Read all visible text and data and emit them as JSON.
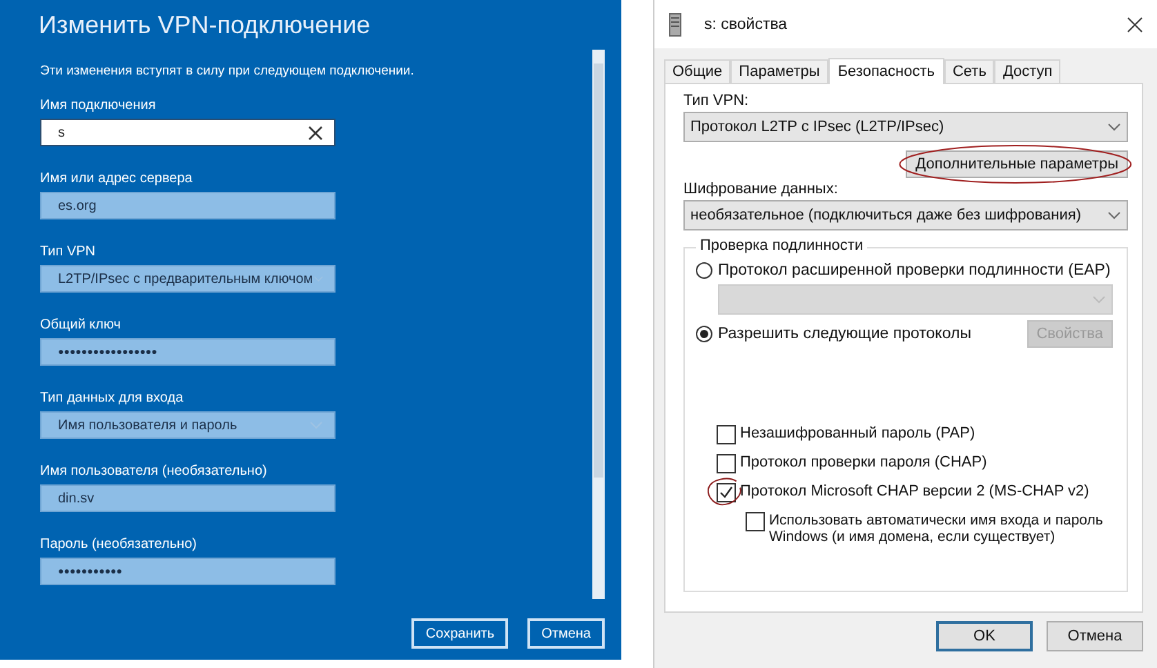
{
  "vpn_panel": {
    "title": "Изменить VPN-подключение",
    "notice": "Эти изменения вступят в силу при следующем подключении.",
    "fields": [
      {
        "label": "Имя подключения",
        "kind": "text",
        "value": "s"
      },
      {
        "label": "Имя или адрес сервера",
        "kind": "filled",
        "value": "es.org"
      },
      {
        "label": "Тип VPN",
        "kind": "select",
        "value": "L2TP/IPsec с предварительным ключом"
      },
      {
        "label": "Общий ключ",
        "kind": "password",
        "value": "●●●●●●●●●●●●●●●●●"
      },
      {
        "label": "Тип данных для входа",
        "kind": "select",
        "value": "Имя пользователя и пароль"
      },
      {
        "label": "Имя пользователя (необязательно)",
        "kind": "filled",
        "value": "din.sv"
      },
      {
        "label": "Пароль (необязательно)",
        "kind": "password",
        "value": "●●●●●●●●●●●"
      }
    ],
    "buttons": [
      "Сохранить",
      "Отмена"
    ]
  },
  "properties_dialog": {
    "title": "s: свойства",
    "tabs": [
      {
        "label": "Общие",
        "selected": false
      },
      {
        "label": "Параметры",
        "selected": false
      },
      {
        "label": "Безопасность",
        "selected": true
      },
      {
        "label": "Сеть",
        "selected": false
      },
      {
        "label": "Доступ",
        "selected": false
      }
    ],
    "vpn_type_label": "Тип VPN:",
    "vpn_type_value": "Протокол L2TP с IPsec (L2TP/IPsec)",
    "advanced_button": {
      "label": "Дополнительные параметры",
      "circled": true
    },
    "encryption_label": "Шифрование данных:",
    "encryption_value": "необязательное (подключиться даже без шифрования)",
    "auth_group": {
      "legend": "Проверка подлинности",
      "radios": [
        {
          "label": "Протокол расширенной проверки подлинности (EAP)",
          "selected": false
        },
        {
          "label": "Разрешить следующие протоколы",
          "selected": true
        }
      ],
      "properties_button": {
        "label": "Свойства",
        "disabled": true
      },
      "checkboxes": [
        {
          "label": "Незашифрованный пароль (PAP)",
          "checked": false
        },
        {
          "label": "Протокол проверки пароля (CHAP)",
          "checked": false
        },
        {
          "label": "Протокол Microsoft CHAP версии 2 (MS-CHAP v2)",
          "checked": true,
          "circled": true,
          "children": [
            {
              "label": "Использовать автоматически имя входа и пароль Windows (и имя домена, если существует)",
              "checked": false
            }
          ]
        }
      ]
    },
    "buttons": [
      "OK",
      "Отмена"
    ]
  }
}
